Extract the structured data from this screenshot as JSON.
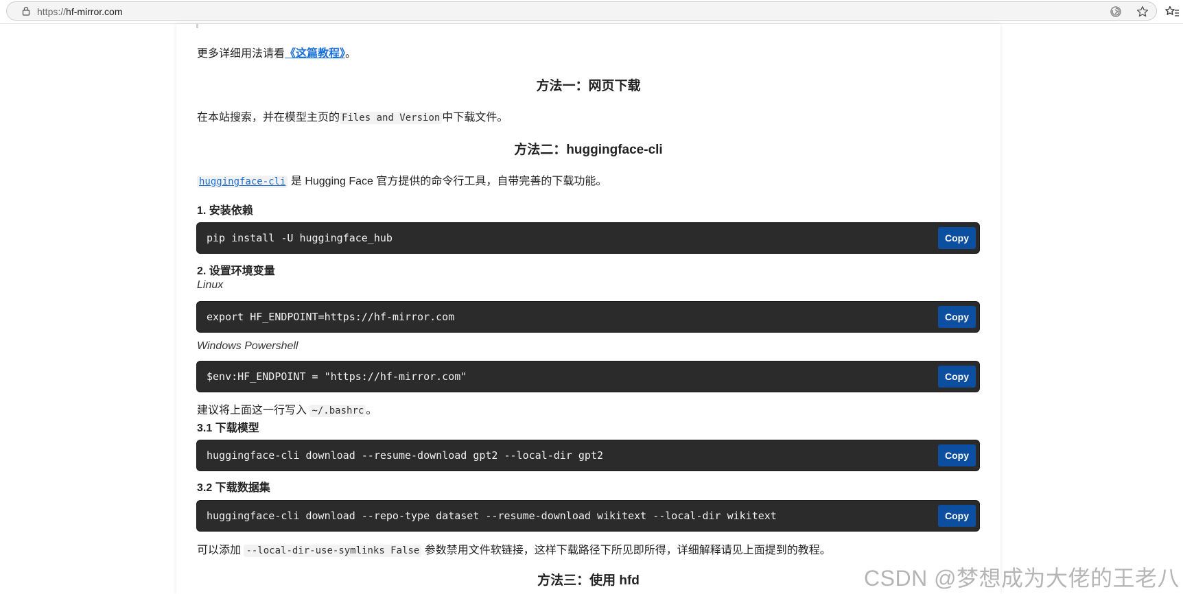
{
  "browser": {
    "url_scheme": "https://",
    "url_host": "hf-mirror.com"
  },
  "content": {
    "intro_link_prefix": "更多详细用法请看",
    "intro_link_text": "《这篇教程》",
    "intro_link_suffix": "。",
    "method1_heading": "方法一：网页下载",
    "method1_text_before": "在本站搜索，并在模型主页的",
    "method1_code": "Files and Version",
    "method1_text_after": "中下载文件。",
    "method2_heading": "方法二：huggingface-cli",
    "method2_cli_link": "huggingface-cli",
    "method2_cli_desc": " 是 Hugging Face 官方提供的命令行工具，自带完善的下载功能。",
    "step1_title": "1. 安装依赖",
    "step1_code": "pip install -U huggingface_hub",
    "step2_title": "2. 设置环境变量",
    "linux_label": "Linux",
    "linux_code": "export HF_ENDPOINT=https://hf-mirror.com",
    "windows_label": "Windows Powershell",
    "windows_code": "$env:HF_ENDPOINT = \"https://hf-mirror.com\"",
    "bashrc_before": "建议将上面这一行写入 ",
    "bashrc_code": "~/.bashrc",
    "bashrc_after": "。",
    "step31_title": "3.1 下载模型",
    "step31_code": "huggingface-cli download --resume-download gpt2 --local-dir gpt2",
    "step32_title": "3.2 下载数据集",
    "step32_code": "huggingface-cli download --repo-type dataset --resume-download wikitext --local-dir wikitext",
    "symlink_before": "可以添加 ",
    "symlink_code": "--local-dir-use-symlinks False",
    "symlink_after": " 参数禁用文件软链接，这样下载路径下所见即所得，详细解释请见上面提到的教程。",
    "method3_heading": "方法三：使用 hfd",
    "copy_label": "Copy"
  },
  "watermark": "CSDN @梦想成为大佬的王老八",
  "colors": {
    "link": "#1a6fd8",
    "code_bg": "#2b2b2b",
    "copy_button": "#0c4fa1"
  },
  "icons": {
    "lock": "lock-icon",
    "refresh": "refresh-icon",
    "star": "star-icon",
    "favorites": "favorites-icon"
  }
}
